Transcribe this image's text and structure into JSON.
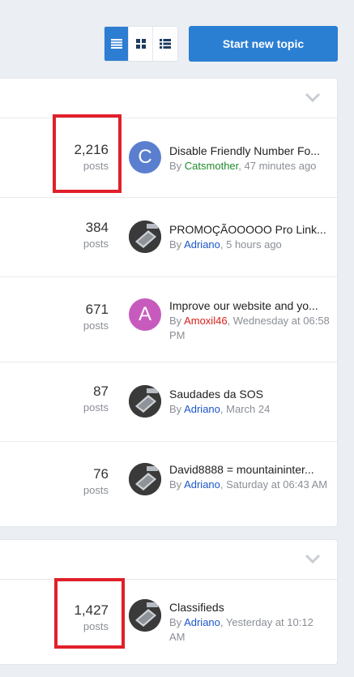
{
  "toolbar": {
    "view_modes": [
      "table-view-icon",
      "grid-view-icon",
      "list-view-icon"
    ],
    "start_label": "Start new topic"
  },
  "colors": {
    "accent": "#2b7fd3",
    "green_user": "#1f8a2a",
    "blue_user": "#1c56c9",
    "red_user": "#d6201a",
    "highlight": "#e0202a"
  },
  "section1": {
    "rows": [
      {
        "count": "2,216",
        "unit": "posts",
        "avatar_letter": "C",
        "avatar_color": "#5b7fcf",
        "title": "Disable Friendly Number Fo...",
        "by": "By ",
        "author": "Catsmother",
        "author_color": "green",
        "time": ", 47 minutes ago"
      },
      {
        "count": "384",
        "unit": "posts",
        "avatar_letter": "",
        "title": "PROMOÇÃOOOOO Pro Link...",
        "by": "By ",
        "author": "Adriano",
        "author_color": "blue",
        "time": ", 5 hours ago"
      },
      {
        "count": "671",
        "unit": "posts",
        "avatar_letter": "A",
        "avatar_color": "#c75bbd",
        "title": "Improve our website and yo...",
        "by": "By ",
        "author": "Amoxil46",
        "author_color": "red",
        "time": ", Wednesday at 06:58 PM"
      },
      {
        "count": "87",
        "unit": "posts",
        "avatar_letter": "",
        "title": "Saudades da SOS",
        "by": "By ",
        "author": "Adriano",
        "author_color": "blue",
        "time": ", March 24"
      },
      {
        "count": "76",
        "unit": "posts",
        "avatar_letter": "",
        "title": "David8888 = mountaininter...",
        "by": "By ",
        "author": "Adriano",
        "author_color": "blue",
        "time": ", Saturday at 06:43 AM"
      }
    ]
  },
  "section2": {
    "rows": [
      {
        "count": "1,427",
        "unit": "posts",
        "avatar_letter": "",
        "title": "Classifieds",
        "by": "By ",
        "author": "Adriano",
        "author_color": "blue",
        "time": ", Yesterday at 10:12 AM"
      }
    ]
  }
}
